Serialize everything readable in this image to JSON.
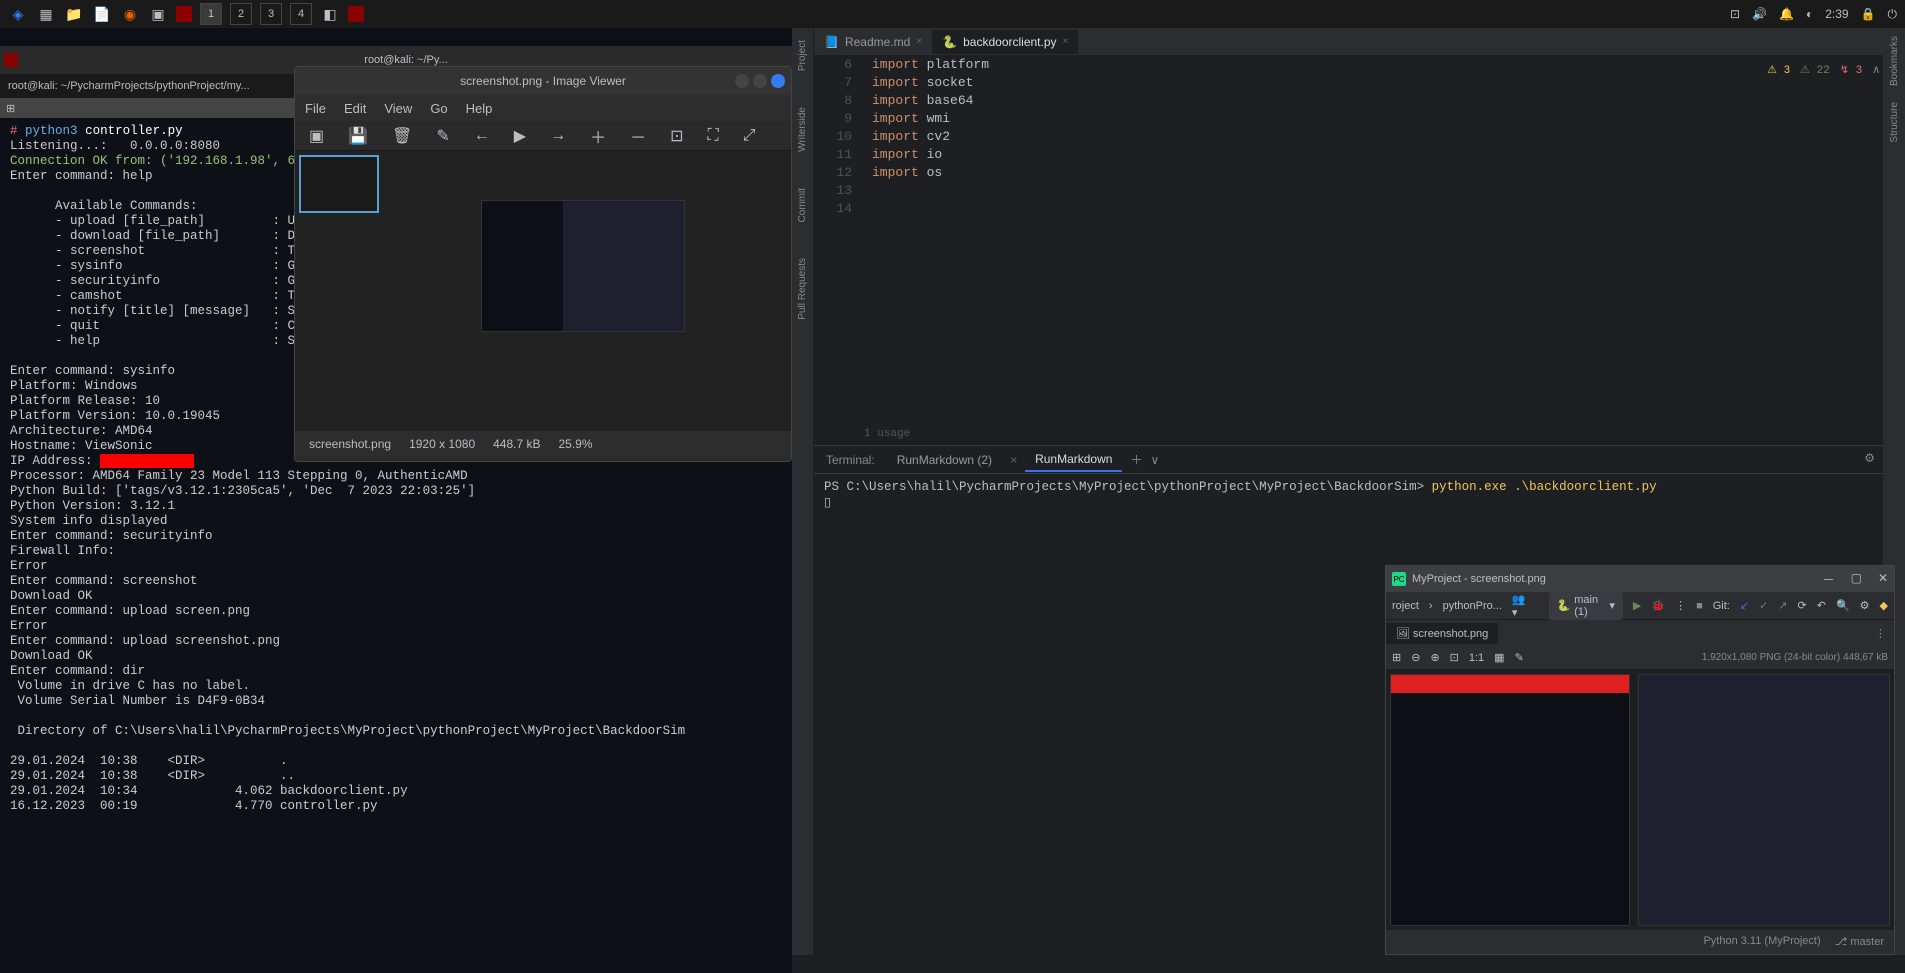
{
  "taskbar": {
    "workspaces": [
      "1",
      "2",
      "3",
      "4"
    ],
    "time": "2:39"
  },
  "terminal": {
    "tab1": "root@kali: ~/Py...",
    "tab_icon": "⊞",
    "splitter_title": "root@kali: ~/Py...",
    "path": "root@kali: ~/PycharmProjects/pythonProject/my...",
    "lines": [
      {
        "type": "cmd",
        "prompt": "# ",
        "text": "python3 controller.py"
      },
      {
        "type": "out",
        "text": "Listening...:   0.0.0.0:8080"
      },
      {
        "type": "conn",
        "text": "Connection OK from: ('192.168.1.98', 63696)"
      },
      {
        "type": "out",
        "text": "Enter command: help"
      },
      {
        "type": "out",
        "text": ""
      },
      {
        "type": "out",
        "text": "      Available Commands:"
      },
      {
        "type": "out",
        "text": "      - upload [file_path]         : Upl"
      },
      {
        "type": "out",
        "text": "      - download [file_path]       : Dow"
      },
      {
        "type": "out",
        "text": "      - screenshot                 : Tak"
      },
      {
        "type": "out",
        "text": "      - sysinfo                    : Get"
      },
      {
        "type": "out",
        "text": "      - securityinfo               : Get"
      },
      {
        "type": "out",
        "text": "      - camshot                    : Tak"
      },
      {
        "type": "out",
        "text": "      - notify [title] [message]   : Sen"
      },
      {
        "type": "out",
        "text": "      - quit                       : Clo"
      },
      {
        "type": "out",
        "text": "      - help                       : Sho"
      },
      {
        "type": "out",
        "text": ""
      },
      {
        "type": "out",
        "text": "Enter command: sysinfo"
      },
      {
        "type": "out",
        "text": "Platform: Windows"
      },
      {
        "type": "out",
        "text": "Platform Release: 10"
      },
      {
        "type": "out",
        "text": "Platform Version: 10.0.19045"
      },
      {
        "type": "out",
        "text": "Architecture: AMD64"
      },
      {
        "type": "out",
        "text": "Hostname: ViewSonic"
      },
      {
        "type": "redact",
        "text": "IP Address: "
      },
      {
        "type": "out",
        "text": "Processor: AMD64 Family 23 Model 113 Stepping 0, AuthenticAMD"
      },
      {
        "type": "out",
        "text": "Python Build: ['tags/v3.12.1:2305ca5', 'Dec  7 2023 22:03:25']"
      },
      {
        "type": "out",
        "text": "Python Version: 3.12.1"
      },
      {
        "type": "out",
        "text": "System info displayed"
      },
      {
        "type": "out",
        "text": "Enter command: securityinfo"
      },
      {
        "type": "out",
        "text": "Firewall Info:"
      },
      {
        "type": "out",
        "text": "Error"
      },
      {
        "type": "out",
        "text": "Enter command: screenshot"
      },
      {
        "type": "out",
        "text": "Download OK"
      },
      {
        "type": "out",
        "text": "Enter command: upload screen.png"
      },
      {
        "type": "out",
        "text": "Error"
      },
      {
        "type": "out",
        "text": "Enter command: upload screenshot.png"
      },
      {
        "type": "out",
        "text": "Download OK"
      },
      {
        "type": "out",
        "text": "Enter command: dir"
      },
      {
        "type": "out",
        "text": " Volume in drive C has no label."
      },
      {
        "type": "out",
        "text": " Volume Serial Number is D4F9-0B34"
      },
      {
        "type": "out",
        "text": ""
      },
      {
        "type": "out",
        "text": " Directory of C:\\Users\\halil\\PycharmProjects\\MyProject\\pythonProject\\MyProject\\BackdoorSim"
      },
      {
        "type": "out",
        "text": ""
      },
      {
        "type": "out",
        "text": "29.01.2024  10:38    <DIR>          ."
      },
      {
        "type": "out",
        "text": "29.01.2024  10:38    <DIR>          .."
      },
      {
        "type": "out",
        "text": "29.01.2024  10:34             4.062 backdoorclient.py"
      },
      {
        "type": "out",
        "text": "16.12.2023  00:19             4.770 controller.py"
      }
    ]
  },
  "imageviewer": {
    "title": "screenshot.png - Image Viewer",
    "menu": [
      "File",
      "Edit",
      "View",
      "Go",
      "Help"
    ],
    "status_file": "screenshot.png",
    "status_dim": "1920 x 1080",
    "status_size": "448.7 kB",
    "status_pct": "25.9%"
  },
  "ide": {
    "sidebar_labels": [
      "Project",
      "Writerside",
      "Commit",
      "Pull Requests"
    ],
    "right_labels": [
      "Bookmarks",
      "Structure"
    ],
    "tabs": [
      {
        "icon": "📘",
        "label": "Readme.md",
        "active": false
      },
      {
        "icon": "🐍",
        "label": "backdoorclient.py",
        "active": true
      }
    ],
    "indicators": {
      "warn": "3",
      "weak": "22",
      "err": "3"
    },
    "code": [
      {
        "n": "6",
        "kw": "import",
        "m": "platform"
      },
      {
        "n": "7",
        "kw": "import",
        "m": "socket"
      },
      {
        "n": "8",
        "kw": "import",
        "m": "base64"
      },
      {
        "n": "9",
        "kw": "import",
        "m": "wmi"
      },
      {
        "n": "10",
        "kw": "import",
        "m": "cv2"
      },
      {
        "n": "11",
        "kw": "import",
        "m": "io"
      },
      {
        "n": "12",
        "kw": "import",
        "m": "os"
      },
      {
        "n": "13",
        "kw": "",
        "m": ""
      },
      {
        "n": "14",
        "kw": "",
        "m": ""
      }
    ],
    "usage_hint": "1 usage",
    "terminal": {
      "label": "Terminal:",
      "tabs": [
        "RunMarkdown (2)",
        "RunMarkdown"
      ],
      "prompt": "PS C:\\Users\\halil\\PycharmProjects\\MyProject\\pythonProject\\MyProject\\BackdoorSim>",
      "cmd": "python.exe .\\backdoorclient.py"
    }
  },
  "pycharm_popup": {
    "title": "MyProject - screenshot.png",
    "breadcrumb": [
      "roject",
      "pythonPro..."
    ],
    "runconfig": "main (1)",
    "git_label": "Git:",
    "tab": "screenshot.png",
    "img_info": "1,920x1,080 PNG (24-bit color) 448,67 kB",
    "ratio": "1:1",
    "status_python": "Python 3.11 (MyProject)",
    "status_branch": "master"
  }
}
